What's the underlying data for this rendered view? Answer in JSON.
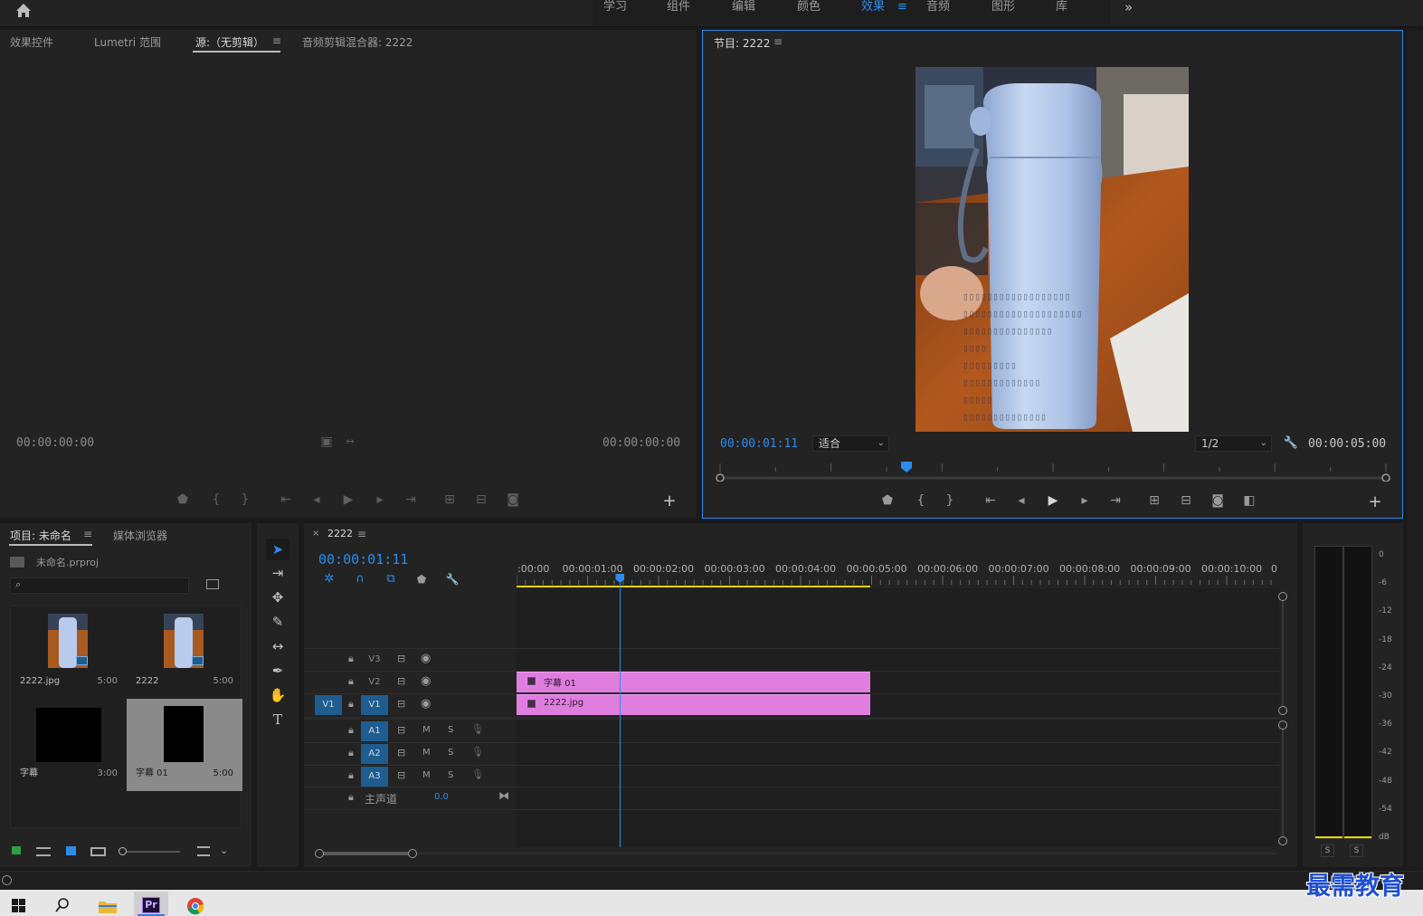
{
  "workspaces": [
    "学习",
    "组件",
    "编辑",
    "颜色",
    "效果",
    "音频",
    "图形",
    "库"
  ],
  "workspace_active": "效果",
  "workspace_menu_glyph": "≡",
  "workspace_more_glyph": "»",
  "source_panel": {
    "tabs": [
      "效果控件",
      "Lumetri 范围",
      "源:（无剪辑）",
      "音频剪辑混合器: 2222"
    ],
    "active_tab": "源:（无剪辑）",
    "menu_glyph": "≡",
    "timecode_left": "00:00:00:00",
    "timecode_right": "00:00:00:00",
    "add_glyph": "+"
  },
  "program_monitor": {
    "title": "节目: 2222",
    "menu_glyph": "≡",
    "timecode": "00:00:01:11",
    "fit_label": "适合",
    "resolution": "1/2",
    "duration": "00:00:05:00",
    "add_glyph": "+",
    "playhead_fraction": 0.28
  },
  "project_panel": {
    "tabs": [
      "项目: 未命名",
      "媒体浏览器"
    ],
    "active_tab": "项目: 未命名",
    "menu_glyph": "≡",
    "project_file": "未命名.prproj",
    "search_placeholder": "",
    "items": [
      {
        "name": "2222.jpg",
        "duration": "5:00"
      },
      {
        "name": "2222",
        "duration": "5:00"
      },
      {
        "name": "字幕",
        "duration": "3:00"
      },
      {
        "name": "字幕 01",
        "duration": "5:00"
      }
    ]
  },
  "timeline": {
    "sequence_name": "2222",
    "close_glyph": "×",
    "menu_glyph": "≡",
    "timecode": "00:00:01:11",
    "ruler_labels": [
      ":00:00",
      "00:00:01:00",
      "00:00:02:00",
      "00:00:03:00",
      "00:00:04:00",
      "00:00:05:00",
      "00:00:06:00",
      "00:00:07:00",
      "00:00:08:00",
      "00:00:09:00",
      "00:00:10:00",
      "0"
    ],
    "video_tracks": [
      "V3",
      "V2",
      "V1"
    ],
    "source_patch_video": "V1",
    "audio_tracks": [
      "A1",
      "A2",
      "A3"
    ],
    "track_mute": "M",
    "track_solo": "S",
    "master_label": "主声道",
    "master_value": "0.0",
    "clips": [
      {
        "track": "V2",
        "name": "字幕 01"
      },
      {
        "track": "V1",
        "name": "2222.jpg"
      }
    ]
  },
  "audio_meter": {
    "labels": [
      "0",
      "-6",
      "-12",
      "-18",
      "-24",
      "-30",
      "-36",
      "-42",
      "-48",
      "-54",
      "dB"
    ],
    "solo_buttons": [
      "S",
      "S"
    ]
  },
  "watermark": "最需教育",
  "taskbar": {
    "apps": [
      "start-icon",
      "search-icon",
      "file-explorer-icon",
      "premiere-icon",
      "chrome-icon"
    ],
    "premiere_label": "Pr"
  },
  "colors": {
    "accent": "#2d8ceb",
    "clip": "#e07ee0",
    "track_target": "#1f5c8f",
    "work_area": "#e6d400"
  }
}
